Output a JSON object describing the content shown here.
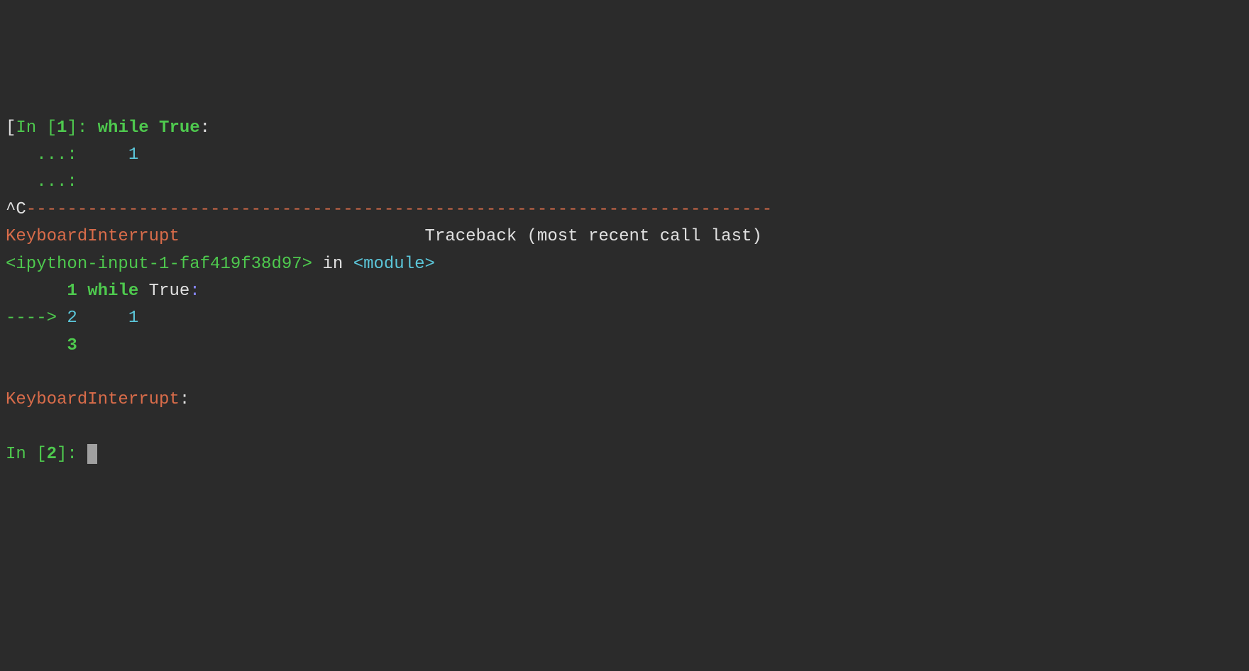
{
  "prompt1": {
    "bracket_open": "[",
    "in_text": "In [",
    "num": "1",
    "close": "]: ",
    "code_keyword": "while",
    "code_true": " True",
    "code_colon": ":"
  },
  "continuation1": {
    "prefix": "   ...: ",
    "value": "    1"
  },
  "continuation2": {
    "prefix": "   ...: "
  },
  "interrupt": {
    "ctrl_c": "^C",
    "dashes": "-------------------------------------------------------------------------"
  },
  "traceback": {
    "error_name": "KeyboardInterrupt",
    "spaces": "                        ",
    "traceback_text": "Traceback (most recent call last)"
  },
  "location": {
    "input_ref": "<ipython-input-1-faf419f38d97>",
    "in_text": " in ",
    "module": "<module>"
  },
  "code_line1": {
    "prefix": "      ",
    "num": "1",
    "code_while": " while",
    "code_true": " True",
    "colon": ":"
  },
  "code_line2": {
    "arrow": "----> ",
    "num": "2",
    "value": "     1"
  },
  "code_line3": {
    "prefix": "      ",
    "num": "3"
  },
  "error_final": {
    "name": "KeyboardInterrupt",
    "colon": ": "
  },
  "prompt2": {
    "in_text": "In [",
    "num": "2",
    "close": "]: "
  }
}
